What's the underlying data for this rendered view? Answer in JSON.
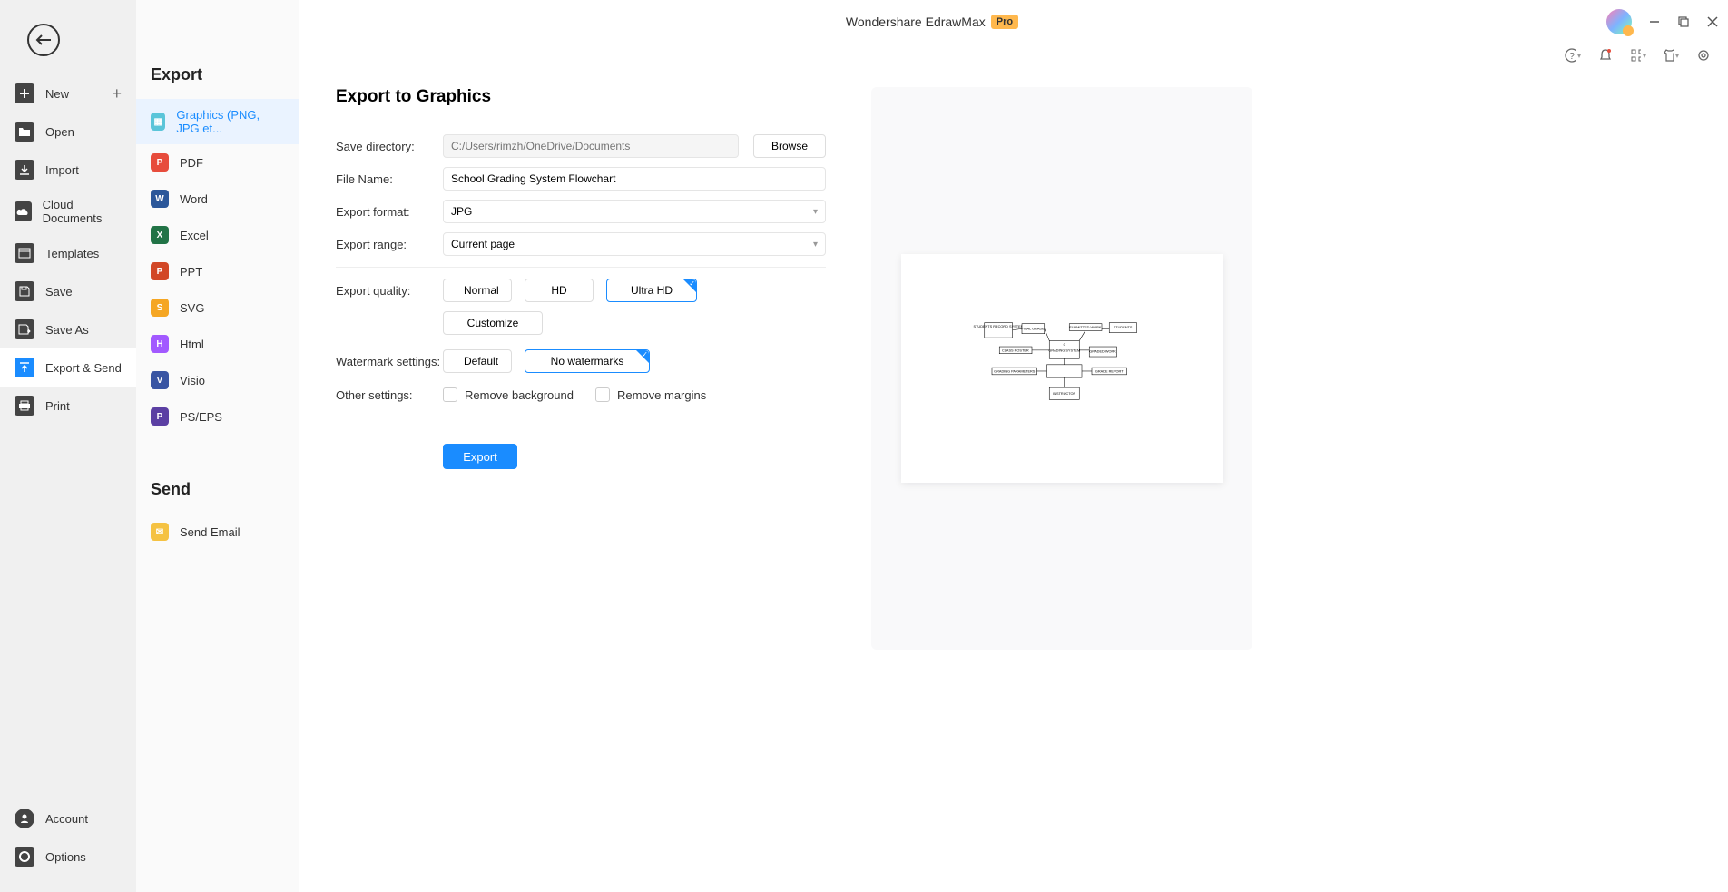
{
  "window": {
    "title": "Wondershare EdrawMax",
    "badge": "Pro"
  },
  "sidebar": {
    "items": [
      {
        "label": "New"
      },
      {
        "label": "Open"
      },
      {
        "label": "Import"
      },
      {
        "label": "Cloud Documents"
      },
      {
        "label": "Templates"
      },
      {
        "label": "Save"
      },
      {
        "label": "Save As"
      },
      {
        "label": "Export & Send"
      },
      {
        "label": "Print"
      }
    ],
    "bottom": [
      {
        "label": "Account"
      },
      {
        "label": "Options"
      }
    ]
  },
  "export_panel": {
    "section1_title": "Export",
    "section2_title": "Send",
    "formats": [
      {
        "label": "Graphics (PNG, JPG et..."
      },
      {
        "label": "PDF"
      },
      {
        "label": "Word"
      },
      {
        "label": "Excel"
      },
      {
        "label": "PPT"
      },
      {
        "label": "SVG"
      },
      {
        "label": "Html"
      },
      {
        "label": "Visio"
      },
      {
        "label": "PS/EPS"
      }
    ],
    "send_items": [
      {
        "label": "Send Email"
      }
    ]
  },
  "form": {
    "title": "Export to Graphics",
    "labels": {
      "save_dir": "Save directory:",
      "filename": "File Name:",
      "format": "Export format:",
      "range": "Export range:",
      "quality": "Export quality:",
      "watermark": "Watermark settings:",
      "other": "Other settings:"
    },
    "values": {
      "save_dir_placeholder": "C:/Users/rimzh/OneDrive/Documents",
      "filename": "School Grading System Flowchart",
      "format": "JPG",
      "range": "Current page"
    },
    "buttons": {
      "browse": "Browse",
      "normal": "Normal",
      "hd": "HD",
      "ultra": "Ultra HD",
      "customize": "Customize",
      "default": "Default",
      "nowm": "No watermarks",
      "export": "Export"
    },
    "checkboxes": {
      "rm_bg": "Remove background",
      "rm_margin": "Remove margins"
    }
  },
  "preview_diagram": {
    "boxes": {
      "students_record": "STUDENTS RECORD SYSTEM",
      "final_grade": "FINAL GRADE",
      "submitted_work": "SUBMITTED WORK",
      "students": "STUDENTS",
      "class_roster": "CLASS ROSTER",
      "grading_system": "GRADING SYSTEM",
      "graded_work": "GRADED WORK",
      "grading_params": "GRADING PARAMETERS",
      "grade_report": "GRADE REPORT",
      "instructor": "INSTRUCTOR"
    }
  }
}
